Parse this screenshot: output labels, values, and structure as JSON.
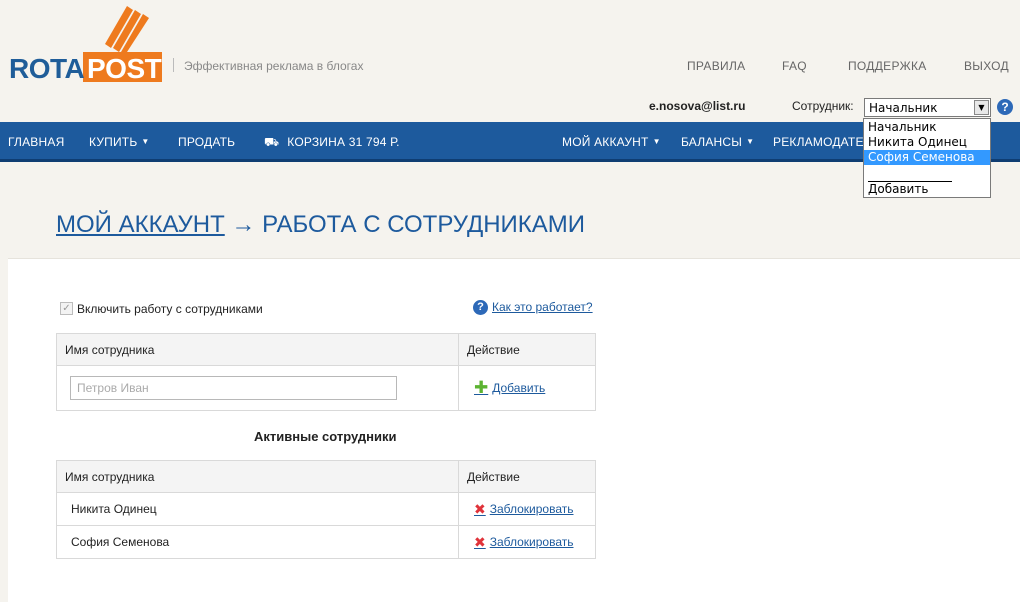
{
  "brand": {
    "logo_part1": "ROTA",
    "logo_part2": "POST",
    "tagline": "Эффективная реклама в блогах"
  },
  "top_links": [
    "ПРАВИЛА",
    "FAQ",
    "ПОДДЕРЖКА",
    "ВЫХОД"
  ],
  "user": {
    "email": "e.nosova@list.ru",
    "employee_label": "Сотрудник:",
    "selected_employee": "Начальник",
    "help": "?"
  },
  "employee_dropdown": {
    "options": [
      "Начальник",
      "Никита Одинец",
      "София Семенова"
    ],
    "highlighted": "София Семенова",
    "add_label": "Добавить"
  },
  "main_nav": {
    "home": "ГЛАВНАЯ",
    "buy": "КУПИТЬ",
    "sell": "ПРОДАТЬ",
    "cart": "КОРЗИНА 31 794 Р.",
    "account": "МОЙ АККАУНТ",
    "balances": "БАЛАНСЫ",
    "advertisers": "РЕКЛАМОДАТЕЛЯМ",
    "caret": "▼"
  },
  "page": {
    "crumb_link": "МОЙ АККАУНТ",
    "arrow": "→",
    "title": "РАБОТА С СОТРУДНИКАМИ"
  },
  "enable": {
    "label": "Включить работу с сотрудниками",
    "checked": true,
    "how_link": "Как это работает?"
  },
  "add_table": {
    "headers": [
      "Имя сотрудника",
      "Действие"
    ],
    "input_placeholder": "Петров Иван",
    "add_action": "Добавить"
  },
  "active": {
    "heading": "Активные сотрудники",
    "headers": [
      "Имя сотрудника",
      "Действие"
    ],
    "rows": [
      {
        "name": "Никита Одинец",
        "action": "Заблокировать"
      },
      {
        "name": "София Семенова",
        "action": "Заблокировать"
      }
    ]
  },
  "colors": {
    "brand_blue": "#1d5a9d",
    "brand_orange": "#ee7a1e",
    "background": "#f5f3ee"
  }
}
